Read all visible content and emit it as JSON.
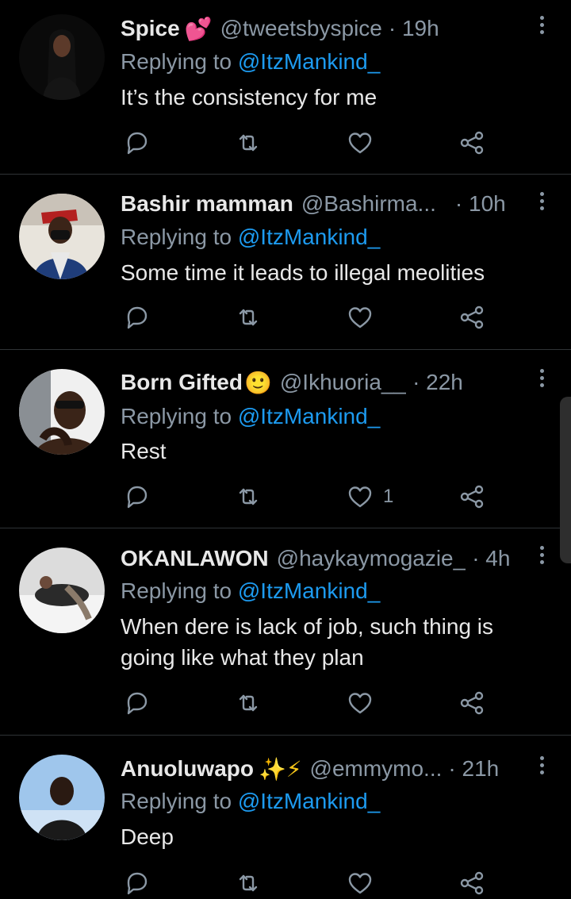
{
  "reply_prefix": "Replying to",
  "tweets": [
    {
      "name": "Spice",
      "name_emoji": "💕",
      "handle": "@tweetsbyspice",
      "time": "· 19h",
      "reply_to": "@ItzMankind_",
      "text": "It’s the consistency for me",
      "likes": ""
    },
    {
      "name": "Bashir mamman",
      "name_emoji": "",
      "handle": "@Bashirma...",
      "time": "· 10h",
      "reply_to": "@ItzMankind_",
      "text": "Some time it leads to illegal meolities",
      "likes": ""
    },
    {
      "name": "Born Gifted",
      "name_emoji": "🙂",
      "handle": "@Ikhuoria__",
      "time": "· 22h",
      "reply_to": "@ItzMankind_",
      "text": "Rest",
      "likes": "1"
    },
    {
      "name": "OKANLAWON",
      "name_emoji": "",
      "handle": "@haykaymogazie_",
      "time": "· 4h",
      "reply_to": "@ItzMankind_",
      "text": "When dere is lack of job, such thing is going like what they plan",
      "likes": ""
    },
    {
      "name": "Anuoluwapo",
      "name_emoji": "✨⚡",
      "handle": "@emmymo...",
      "time": "· 21h",
      "reply_to": "@ItzMankind_",
      "text": "Deep",
      "likes": ""
    }
  ],
  "colors": {
    "background": "#000000",
    "link": "#1d9bf0",
    "muted": "#8b98a5",
    "divider": "#2f3336"
  },
  "icons": [
    "reply-icon",
    "retweet-icon",
    "like-icon",
    "share-icon",
    "more-options-icon"
  ]
}
